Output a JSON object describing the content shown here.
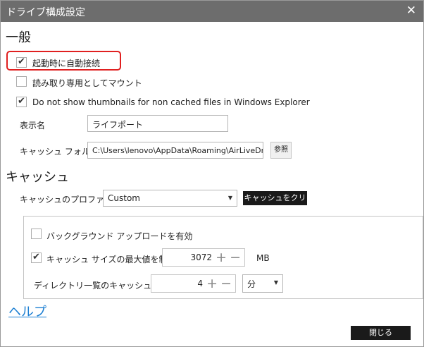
{
  "window": {
    "title": "ドライブ構成設定",
    "close_glyph": "✕"
  },
  "general": {
    "heading": "一般",
    "auto_connect": {
      "label": "起動時に自動接続",
      "checked": true
    },
    "read_only": {
      "label": "読み取り専用としてマウント",
      "checked": false
    },
    "no_thumbnails": {
      "label": "Do not show thumbnails for non cached files in Windows Explorer",
      "checked": true
    },
    "display_name": {
      "label": "表示名",
      "value": "ライフポート"
    },
    "cache_folder": {
      "label": "キャッシュ フォルダ",
      "value": "C:\\Users\\lenovo\\AppData\\Roaming\\AirLiveDr",
      "browse_label": "参照"
    }
  },
  "cache": {
    "heading": "キャッシュ",
    "profile": {
      "label": "キャッシュのプロファイル",
      "value": "Custom"
    },
    "clear_label": "キャッシュをクリア",
    "background_upload": {
      "label": "バックグラウンド アップロードを有効",
      "checked": false
    },
    "max_size": {
      "label": "キャッシュ サイズの最大値を制限",
      "checked": true,
      "value": "3072",
      "unit": "MB"
    },
    "dir_cache_time": {
      "label": "ディレクトリ一覧のキャッシュ時間",
      "value": "4",
      "unit": "分"
    }
  },
  "footer": {
    "help_label": "ヘルプ",
    "close_label": "閉じる"
  },
  "glyphs": {
    "check": "✔",
    "plus": "+",
    "minus": "−",
    "dropdown": "▼"
  },
  "colors": {
    "titlebar": "#6d6d6d",
    "highlight": "#e02020",
    "link": "#1a7ed2"
  }
}
